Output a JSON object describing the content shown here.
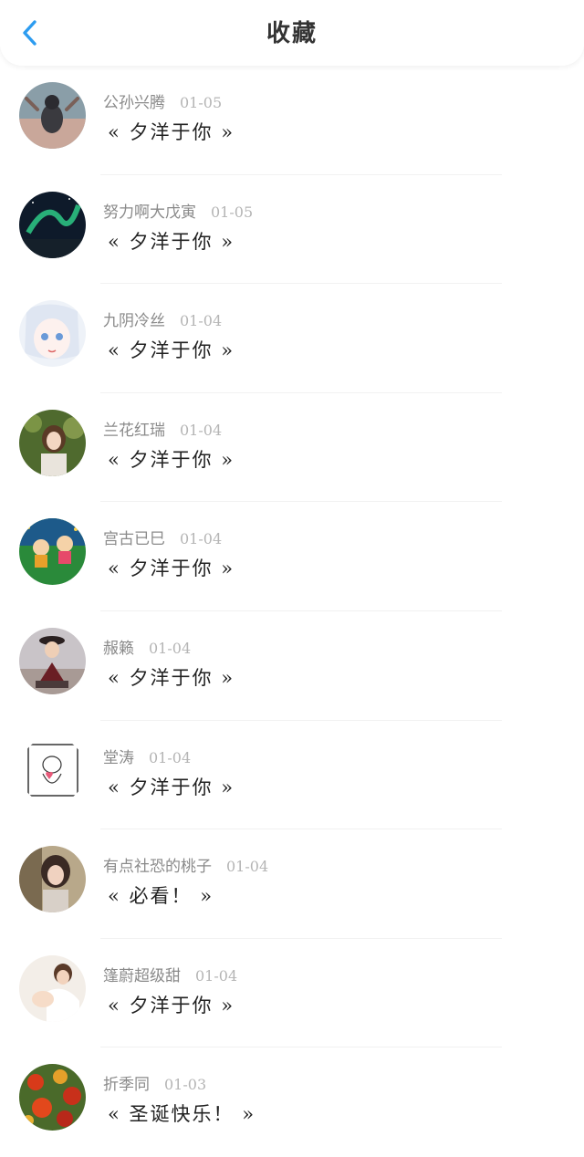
{
  "header": {
    "title": "收藏",
    "back_icon": "chevron-left-icon",
    "accent_color": "#2d9cf0"
  },
  "favorites": [
    {
      "name": "公孙兴腾",
      "date": "01-05",
      "message": "« 夕洋于你 »"
    },
    {
      "name": "努力啊大戊寅",
      "date": "01-05",
      "message": "« 夕洋于你 »"
    },
    {
      "name": "九阴冷丝",
      "date": "01-04",
      "message": "« 夕洋于你 »"
    },
    {
      "name": "兰花红瑞",
      "date": "01-04",
      "message": "« 夕洋于你 »"
    },
    {
      "name": "宫古已巳",
      "date": "01-04",
      "message": "« 夕洋于你 »"
    },
    {
      "name": "赧籁",
      "date": "01-04",
      "message": "« 夕洋于你 »"
    },
    {
      "name": "堂涛",
      "date": "01-04",
      "message": "« 夕洋于你 »"
    },
    {
      "name": "有点社恐的桃子",
      "date": "01-04",
      "message": "« 必看！ »"
    },
    {
      "name": "篷蔚超级甜",
      "date": "01-04",
      "message": "« 夕洋于你 »"
    },
    {
      "name": "折季同",
      "date": "01-03",
      "message": "« 圣诞快乐！ »"
    }
  ]
}
